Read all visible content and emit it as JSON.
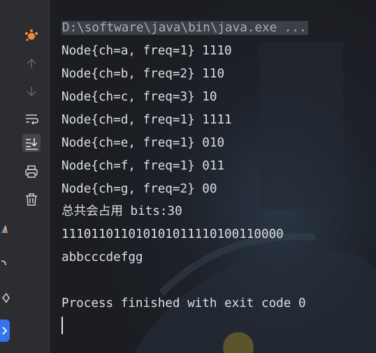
{
  "console": {
    "command": "D:\\software\\java\\bin\\java.exe ...",
    "lines": [
      "Node{ch=a, freq=1} 1110",
      "Node{ch=b, freq=2} 110",
      "Node{ch=c, freq=3} 10",
      "Node{ch=d, freq=1} 1111",
      "Node{ch=e, freq=1} 010",
      "Node{ch=f, freq=1} 011",
      "Node{ch=g, freq=2} 00",
      "总共会占用 bits:30",
      "111011011010101011110100110000",
      "abbcccdefgg",
      "",
      "Process finished with exit code 0"
    ]
  },
  "toolbar": {
    "icons": [
      "run-debug-icon",
      "arrow-up-icon",
      "arrow-down-icon",
      "soft-wrap-icon",
      "scroll-to-end-icon",
      "print-icon",
      "trash-icon"
    ]
  },
  "colors": {
    "background": "#1e2027",
    "toolbar_bg": "#2b2d30",
    "text": "#dcdfe4",
    "accent_orange": "#f08a3b",
    "accent_blue": "#3574f0"
  }
}
